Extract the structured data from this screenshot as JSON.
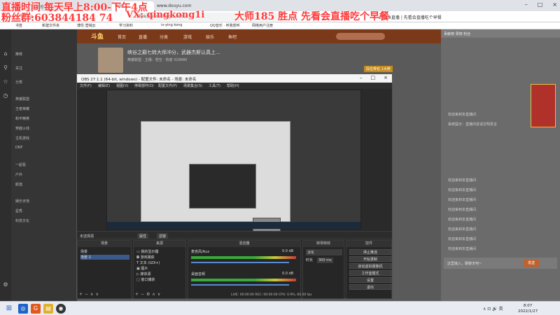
{
  "browser": {
    "tabs": [
      {
        "label": "直播间",
        "active": false
      },
      {
        "label": "Bilib",
        "active": true
      },
      {
        "label": "www.douyu.com",
        "active": false
      }
    ],
    "url": "https://www.douyu.com/",
    "nav_right": "⊕ 斗鱼直播 | 先看会直播吃个早餐",
    "bookmarks": [
      "书签",
      "新建文件夹",
      "博优·营销云",
      "学习资料",
      "ix-ying kong",
      "QQ音乐 · 听我想听",
      "网络用户注册"
    ]
  },
  "overlay": {
    "line1": "直播时间 每天早上8:00-下午4点",
    "line2": "粉丝群:603844184 74",
    "vx": "VX: qingkong1i",
    "master": "大师185 胜点 先看会直播吃个早餐"
  },
  "sidebar": {
    "rows": [
      "推荐",
      "关注",
      "分类",
      "英雄联盟",
      "王者荣耀",
      "和平精英",
      "穿越火线",
      "主机游戏",
      "DNF",
      "一起看",
      "户外",
      "颜值",
      "娱乐天地",
      "星秀",
      "科技文化"
    ]
  },
  "site": {
    "logo": "斗鱼",
    "nav": [
      "首页",
      "直播",
      "分类",
      "游戏",
      "娱乐",
      "鱼吧"
    ],
    "room_title": "峡谷之巅七转大师冲分，武器杰斯认真上...",
    "room_sub": "英雄联盟 · 主播：轻空 · 热度 316680",
    "rank": "段位排名 1大佬"
  },
  "chat": {
    "header": "贡献榜   周榜   粉丝",
    "lines": [
      "欢迎来到本直播间",
      "系统提示：直播内容请文明发言",
      "欢迎来到本直播间",
      "欢迎来到本直播间",
      "欢迎来到本直播间",
      "欢迎来到本直播间",
      "欢迎来到本直播间",
      "欢迎来到本直播间",
      "欢迎来到本直播间",
      "欢迎来到本直播间"
    ],
    "input_placeholder": "这里输入，聊聊天吧~",
    "send": "发送"
  },
  "obs": {
    "title": "OBS 27.1.1 (64-bit, windows) - 配置文件: 未命名 - 场景: 未命名",
    "menu": [
      "文件(F)",
      "编辑(E)",
      "视图(V)",
      "停靠部件(D)",
      "配置文件(P)",
      "场景集合(S)",
      "工具(T)",
      "帮助(H)"
    ],
    "scene_bar": "未选择源",
    "toolbar": [
      "属性",
      "滤镜"
    ],
    "docks": {
      "scenes": {
        "title": "场景",
        "items": [
          "场景",
          "场景 2"
        ]
      },
      "sources": {
        "title": "来源",
        "items": [
          "我的显示器",
          "游戏捕获",
          "文本 (GDI+)",
          "图片",
          "媒体源",
          "窗口捕获"
        ]
      },
      "mixer": {
        "title": "混音器",
        "tracks": [
          {
            "name": "麦克风/Aux",
            "db": "0.0 dB"
          },
          {
            "name": "桌面音频",
            "db": "0.0 dB"
          }
        ]
      },
      "transitions": {
        "title": "转场特效",
        "type": "淡化",
        "duration_label": "时长",
        "duration": "300 ms"
      },
      "controls": {
        "title": "控件",
        "buttons": [
          "停止推流",
          "开始录制",
          "启动虚拟摄像机",
          "工作室模式",
          "设置",
          "退出"
        ]
      }
    },
    "status": "LIVE: 00:00:00   REC: 00:00:00   CPU: 0.9%, 60.00 fps"
  },
  "taskbar": {
    "apps": [
      {
        "icon": "search-icon",
        "color": "#1e64c8"
      },
      {
        "icon": "g-icon",
        "color": "#e05a20"
      },
      {
        "icon": "folder-icon",
        "color": "#e0b030"
      },
      {
        "icon": "obs-icon",
        "color": "#333333"
      }
    ],
    "tray": "∧ ⊡ 🔊 英",
    "time": "8:07",
    "date": "2022/1/27"
  },
  "colors": {
    "overlay_red": "#ff3a3a",
    "accent": "#c0612c"
  }
}
